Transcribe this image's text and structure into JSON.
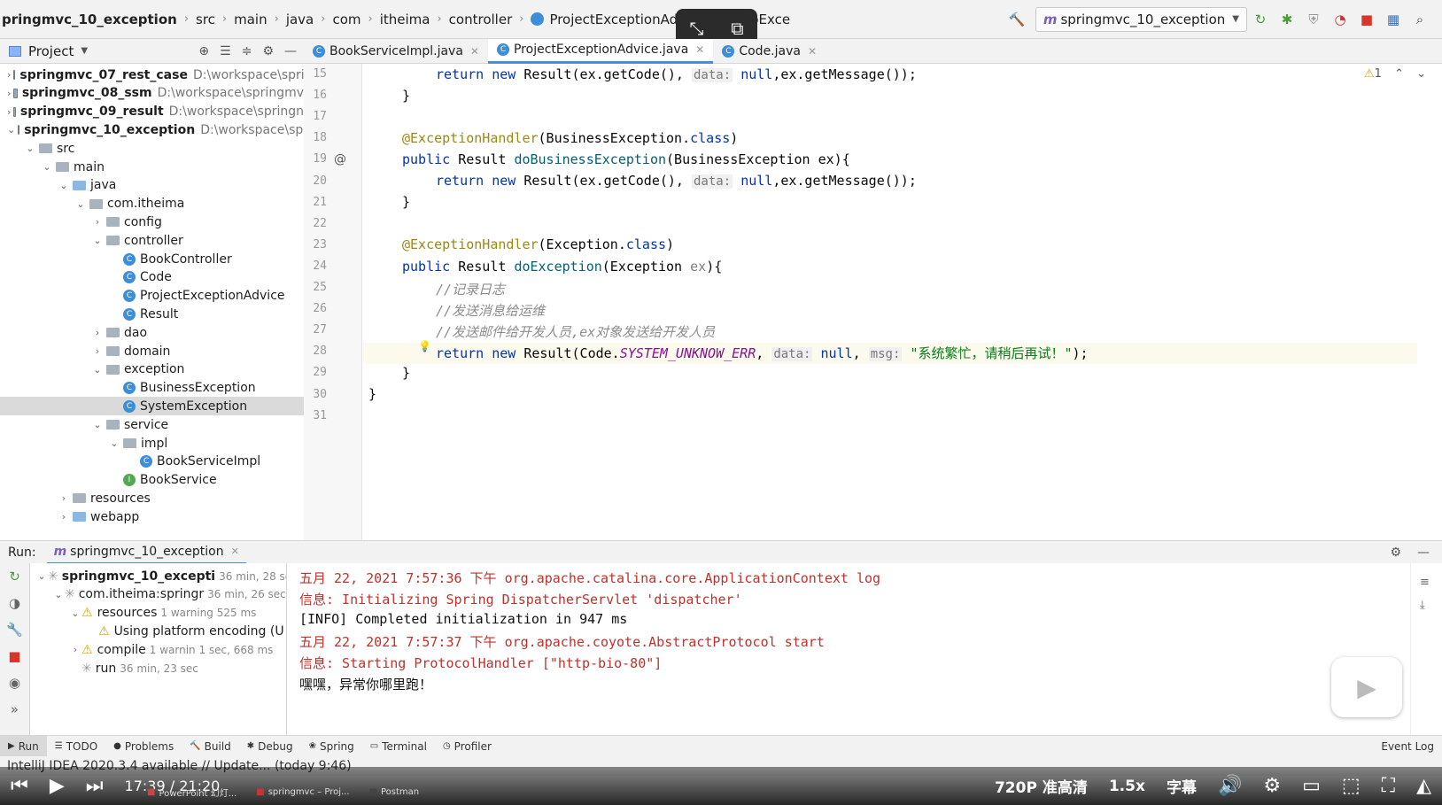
{
  "navbar": {
    "breadcrumb": [
      "pringmvc_10_exception",
      "src",
      "main",
      "java",
      "com",
      "itheima",
      "controller",
      "ProjectExceptionAdvice",
      "doExce"
    ],
    "run_config": "springmvc_10_exception"
  },
  "project_panel": {
    "title": "Project",
    "tree": [
      {
        "depth": 0,
        "arrow": "›",
        "type": "module",
        "label": "springmvc_07_rest_case",
        "path": "D:\\workspace\\spri",
        "bold": true
      },
      {
        "depth": 0,
        "arrow": "›",
        "type": "module",
        "label": "springmvc_08_ssm",
        "path": "D:\\workspace\\springmv",
        "bold": true
      },
      {
        "depth": 0,
        "arrow": "›",
        "type": "module",
        "label": "springmvc_09_result",
        "path": "D:\\workspace\\springn",
        "bold": true
      },
      {
        "depth": 0,
        "arrow": "⌄",
        "type": "module",
        "label": "springmvc_10_exception",
        "path": "D:\\workspace\\spr",
        "bold": true
      },
      {
        "depth": 1,
        "arrow": "⌄",
        "type": "folder",
        "label": "src"
      },
      {
        "depth": 2,
        "arrow": "⌄",
        "type": "folder",
        "label": "main"
      },
      {
        "depth": 3,
        "arrow": "⌄",
        "type": "folder-blue",
        "label": "java"
      },
      {
        "depth": 4,
        "arrow": "⌄",
        "type": "folder",
        "label": "com.itheima"
      },
      {
        "depth": 5,
        "arrow": "›",
        "type": "folder",
        "label": "config"
      },
      {
        "depth": 5,
        "arrow": "⌄",
        "type": "folder",
        "label": "controller"
      },
      {
        "depth": 6,
        "arrow": "",
        "type": "class",
        "label": "BookController"
      },
      {
        "depth": 6,
        "arrow": "",
        "type": "class",
        "label": "Code"
      },
      {
        "depth": 6,
        "arrow": "",
        "type": "class",
        "label": "ProjectExceptionAdvice"
      },
      {
        "depth": 6,
        "arrow": "",
        "type": "class",
        "label": "Result"
      },
      {
        "depth": 5,
        "arrow": "›",
        "type": "folder",
        "label": "dao"
      },
      {
        "depth": 5,
        "arrow": "›",
        "type": "folder",
        "label": "domain"
      },
      {
        "depth": 5,
        "arrow": "⌄",
        "type": "folder",
        "label": "exception"
      },
      {
        "depth": 6,
        "arrow": "",
        "type": "class",
        "label": "BusinessException"
      },
      {
        "depth": 6,
        "arrow": "",
        "type": "class",
        "label": "SystemException",
        "selected": true
      },
      {
        "depth": 5,
        "arrow": "⌄",
        "type": "folder",
        "label": "service"
      },
      {
        "depth": 6,
        "arrow": "⌄",
        "type": "folder",
        "label": "impl"
      },
      {
        "depth": 7,
        "arrow": "",
        "type": "class",
        "label": "BookServiceImpl"
      },
      {
        "depth": 6,
        "arrow": "",
        "type": "interface",
        "label": "BookService"
      },
      {
        "depth": 3,
        "arrow": "›",
        "type": "folder",
        "label": "resources"
      },
      {
        "depth": 3,
        "arrow": "›",
        "type": "folder-blue",
        "label": "webapp"
      }
    ]
  },
  "editor": {
    "tabs": [
      {
        "label": "BookServiceImpl.java",
        "active": false
      },
      {
        "label": "ProjectExceptionAdvice.java",
        "active": true
      },
      {
        "label": "Code.java",
        "active": false
      }
    ],
    "warning_count": "1",
    "line_numbers": [
      "15",
      "16",
      "17",
      "18",
      "19",
      "20",
      "21",
      "22",
      "23",
      "24",
      "25",
      "26",
      "27",
      "28",
      "29",
      "30",
      "31"
    ]
  },
  "run_panel": {
    "label": "Run:",
    "config": "springmvc_10_exception",
    "tree": [
      {
        "depth": 0,
        "icon": "spin",
        "label": "springmvc_10_excepti",
        "time": "36 min, 28 sec",
        "bold": true
      },
      {
        "depth": 1,
        "icon": "spin",
        "label": "com.itheima:springr",
        "time": "36 min, 26 sec"
      },
      {
        "depth": 2,
        "icon": "warn",
        "label": "resources",
        "time": "1 warning     525 ms"
      },
      {
        "depth": 3,
        "icon": "warn",
        "label": "Using platform encoding (U",
        "time": ""
      },
      {
        "depth": 2,
        "icon": "warn",
        "label": "compile",
        "time": "1 warnin 1 sec, 668 ms"
      },
      {
        "depth": 2,
        "icon": "spin",
        "label": "run",
        "time": "36 min, 23 sec"
      }
    ],
    "console": [
      {
        "text": "五月 22, 2021 7:57:36 下午 org.apache.catalina.core.ApplicationContext log",
        "red": true
      },
      {
        "text": "信息: Initializing Spring DispatcherServlet 'dispatcher'",
        "red": true
      },
      {
        "text": "[INFO] Completed initialization in 947 ms",
        "red": false
      },
      {
        "text": "五月 22, 2021 7:57:37 下午 org.apache.coyote.AbstractProtocol start",
        "red": true
      },
      {
        "text": "信息: Starting ProtocolHandler [\"http-bio-80\"]",
        "red": true
      },
      {
        "text": "嘿嘿，异常你哪里跑！",
        "red": false
      }
    ]
  },
  "bottom_tools": [
    "Run",
    "TODO",
    "Problems",
    "Build",
    "Debug",
    "Spring",
    "Terminal",
    "Profiler"
  ],
  "event_log": "Event Log",
  "status_text": "IntelliJ IDEA 2020.3.4 available // Update... (today 9:46)",
  "player": {
    "time": "17:39 / 21:20",
    "quality": "720P 准高清",
    "speed": "1.5x",
    "subtitle": "字幕"
  },
  "taskbar": [
    "PowerPoint 幻灯...",
    "springmvc – Proj...",
    "Postman"
  ]
}
